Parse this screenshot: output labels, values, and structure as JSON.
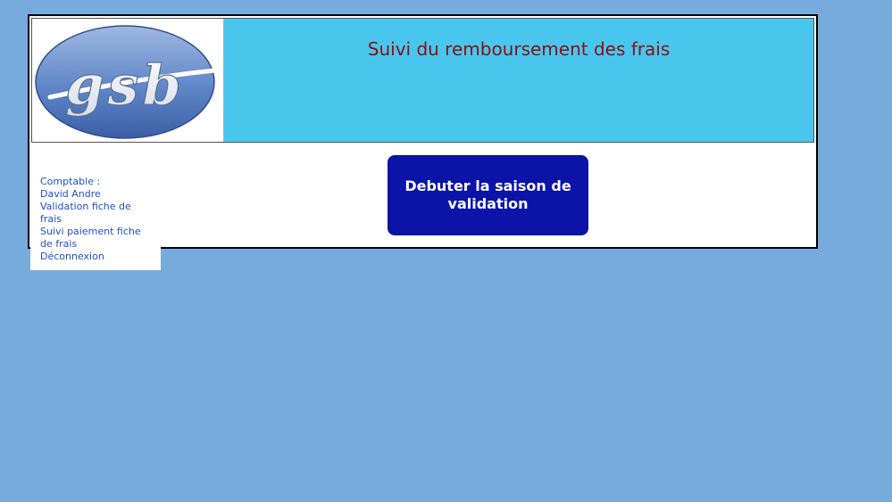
{
  "header": {
    "logo_text": "gsb",
    "title": "Suivi du remboursement des frais"
  },
  "sidebar": {
    "role_label": "Comptable :",
    "user_name": "David Andre",
    "links": [
      {
        "label": "Validation fiche de frais"
      },
      {
        "label": "Suivi paiement fiche de frais"
      },
      {
        "label": "Déconnexion"
      }
    ]
  },
  "main": {
    "start_button_label": "Debuter la saison de validation"
  },
  "colors": {
    "background": "#77abdd",
    "header_bg": "#49c6ee",
    "title": "#8b1010",
    "button_bg": "#0c14a8",
    "link": "#1f4fc9"
  }
}
